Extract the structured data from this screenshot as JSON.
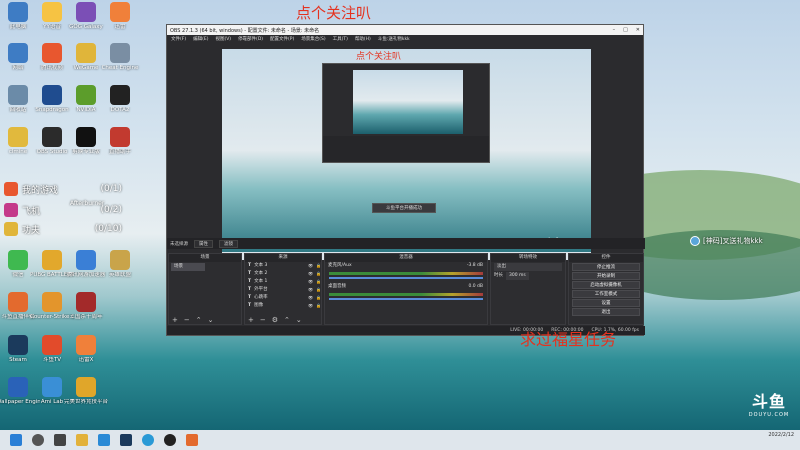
{
  "overlay": {
    "follow_text": "点个关注叭",
    "task_text": "求过福星任务",
    "preview_follow_text": "点个关注叭"
  },
  "desktop_icons": [
    {
      "label": "此电脑",
      "color": "#3e7cc4"
    },
    {
      "label": "YY语音",
      "color": "#f6c343"
    },
    {
      "label": "GOG Galaxy",
      "color": "#7b4fb6"
    },
    {
      "label": "迅雷",
      "color": "#f0803a"
    },
    {
      "label": "网络",
      "color": "#3e7cc4"
    },
    {
      "label": "腾讯视频",
      "color": "#e8572f"
    },
    {
      "label": "WeGame",
      "color": "#e0b53a"
    },
    {
      "label": "Cheat Engine",
      "color": "#7a8ea3"
    },
    {
      "label": "回收站",
      "color": "#6b8ba8"
    },
    {
      "label": "Snapdragon",
      "color": "#1f4c8f"
    },
    {
      "label": "NVIDIA",
      "color": "#5c9d2b"
    },
    {
      "label": "DOTA2",
      "color": "#222222"
    },
    {
      "label": "clmine",
      "color": "#e1b93d"
    },
    {
      "label": "OBS Studio",
      "color": "#2b2b2b"
    },
    {
      "label": "剪映专业版",
      "color": "#111111"
    },
    {
      "label": "直播助手",
      "color": "#c23a2f"
    },
    {
      "label": "微信",
      "color": "#3fb950"
    },
    {
      "label": "PUBG BATTLEGR...",
      "color": "#e2a82c"
    },
    {
      "label": "腾讯网游加速器",
      "color": "#3a7fd6"
    },
    {
      "label": "英雄联盟",
      "color": "#c9a44a"
    },
    {
      "label": "斗鱼直播伴侣",
      "color": "#e36a2e"
    },
    {
      "label": "Counter-Strike Global Off...",
      "color": "#e3952c"
    },
    {
      "label": "三国杀十周年",
      "color": "#a32a2a"
    },
    {
      "label": "Steam",
      "color": "#1b3a5c"
    },
    {
      "label": "斗鱼TV",
      "color": "#e24b2b"
    },
    {
      "label": "迅雷X",
      "color": "#f0803a"
    },
    {
      "label": "Wallpaper Engine",
      "color": "#2a62b8"
    },
    {
      "label": "Ami Lab",
      "color": "#3a8fd6"
    },
    {
      "label": "完美世界竞技平台",
      "color": "#e0a62a"
    }
  ],
  "game_list": [
    {
      "name": "我的游戏",
      "count": "(0/1)",
      "color": "#e8572f"
    },
    {
      "name": "Afterburner",
      "count": "",
      "color": "#b22222"
    },
    {
      "name": "飞机",
      "count": "(0/2)",
      "color": "#c43a8a"
    },
    {
      "name": "功夫",
      "count": "(0/10)",
      "color": "#e0b53a"
    }
  ],
  "obs": {
    "title": "OBS 27.1.3 (64 bit, windows) - 配置文件: 未命名 - 场景: 未命名",
    "menu": [
      "文件(F)",
      "编辑(E)",
      "视图(V)",
      "停靠部件(D)",
      "配置文件(P)",
      "场景集合(S)",
      "工具(T)",
      "帮助(H)",
      "斗鱼:送礼物kkk"
    ],
    "source_status": "未选择源",
    "properties_btn": "属性",
    "filters_btn": "滤镜",
    "preview_popup": "斗鱼平台开播成功",
    "scenes": {
      "header": "场景",
      "items": [
        "场景"
      ]
    },
    "sources": {
      "header": "来源",
      "items": [
        "文本 3",
        "文本 2",
        "文本 1",
        "外平台",
        "心跳率",
        "图像"
      ]
    },
    "mixer": {
      "header": "混音器",
      "channels": [
        {
          "name": "麦克风/Aux",
          "level": "-3.8 dB"
        },
        {
          "name": "桌面音频",
          "level": "0.0 dB"
        }
      ]
    },
    "transitions": {
      "header": "转场特效",
      "type": "淡出",
      "duration_label": "时长",
      "duration": "300 ms"
    },
    "controls": {
      "header": "控件",
      "buttons": [
        "停止推流",
        "开始录制",
        "启动虚拟摄像机",
        "工作室模式",
        "设置",
        "退出"
      ]
    },
    "status": {
      "live": "LIVE: 00:00:00",
      "rec": "REC: 00:00:00",
      "cpu": "CPU: 1.7%, 60.00 fps"
    }
  },
  "notification": "[神码]叉送礼物kkk",
  "watermark": {
    "logo": "斗鱼",
    "sub": "DOUYU.COM"
  },
  "taskbar": {
    "time": "",
    "date": "2022/2/12"
  }
}
